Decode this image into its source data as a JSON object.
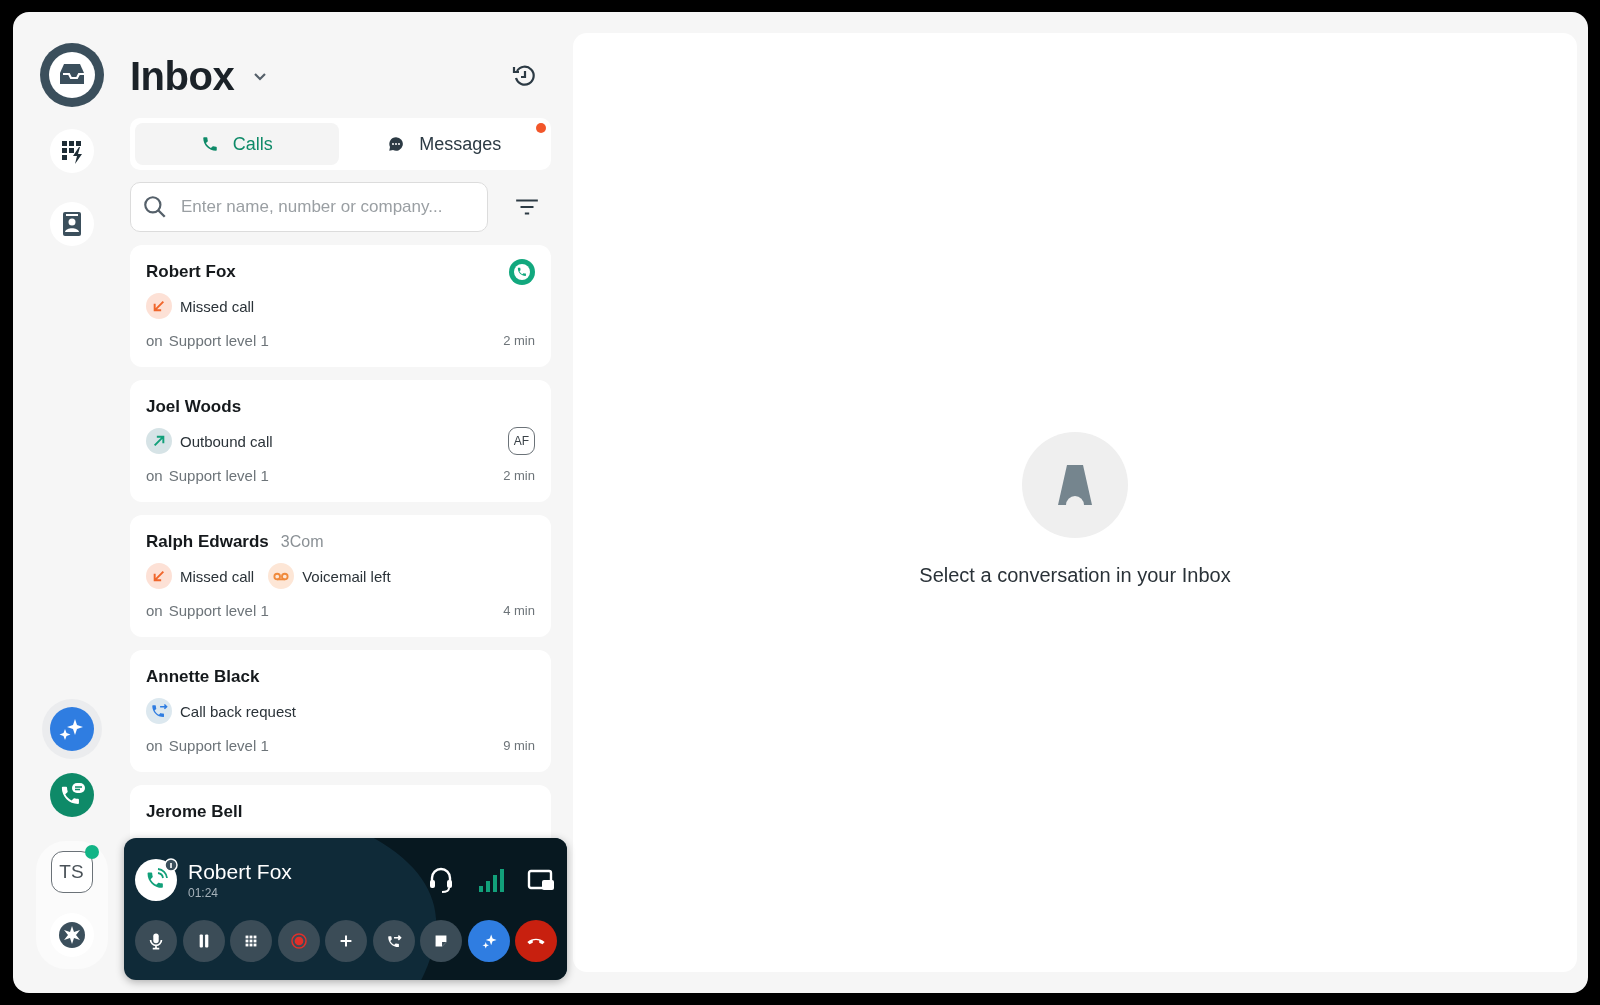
{
  "header": {
    "title": "Inbox"
  },
  "rail": {
    "user": {
      "initials": "TS",
      "online": true
    }
  },
  "tabs": [
    {
      "kind": "calls",
      "label": "Calls",
      "selected": true,
      "unread": false
    },
    {
      "kind": "messages",
      "label": "Messages",
      "selected": false,
      "unread": true
    }
  ],
  "search": {
    "placeholder": "Enter name, number or company..."
  },
  "conversations": [
    {
      "name": "Robert Fox",
      "on_call": true,
      "events": [
        {
          "kind": "missed",
          "label": "Missed call"
        }
      ],
      "queue_prefix": "on",
      "queue": "Support level 1",
      "time": "2 min"
    },
    {
      "name": "Joel Woods",
      "agent": "AF",
      "events": [
        {
          "kind": "outbound",
          "label": "Outbound call"
        }
      ],
      "queue_prefix": "on",
      "queue": "Support level 1",
      "time": "2 min"
    },
    {
      "name": "Ralph Edwards",
      "company": "3Com",
      "events": [
        {
          "kind": "missed",
          "label": "Missed call"
        },
        {
          "kind": "voicemail",
          "label": "Voicemail left"
        }
      ],
      "queue_prefix": "on",
      "queue": "Support level 1",
      "time": "4 min"
    },
    {
      "name": "Annette Black",
      "events": [
        {
          "kind": "callback",
          "label": "Call back request"
        }
      ],
      "queue_prefix": "on",
      "queue": "Support level 1",
      "time": "9 min"
    },
    {
      "name": "Jerome Bell"
    }
  ],
  "call": {
    "name": "Robert Fox",
    "duration": "01:24",
    "controls": [
      {
        "kind": "mute"
      },
      {
        "kind": "hold"
      },
      {
        "kind": "keypad"
      },
      {
        "kind": "record"
      },
      {
        "kind": "add"
      },
      {
        "kind": "transfer"
      },
      {
        "kind": "note"
      },
      {
        "kind": "assist"
      },
      {
        "kind": "hangup"
      }
    ]
  },
  "empty_state": {
    "message": "Select a conversation in your Inbox"
  }
}
